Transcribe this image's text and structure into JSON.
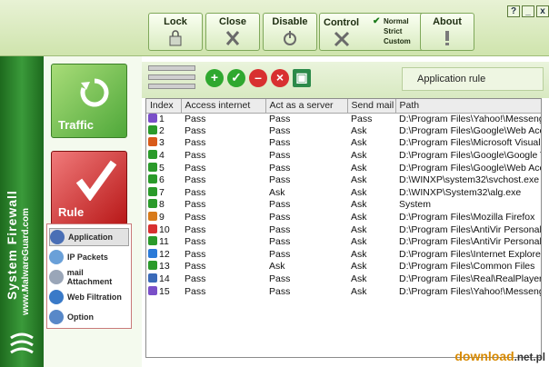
{
  "window": {
    "controls": [
      "?",
      "_",
      "x"
    ],
    "buttons": {
      "lock": "Lock",
      "close": "Close",
      "disable": "Disable",
      "control": "Control",
      "about": "About"
    },
    "modes": {
      "normal": "Normal",
      "strict": "Strict",
      "custom": "Custom",
      "selected": "Normal"
    }
  },
  "brand": {
    "title": "System Firewall",
    "site": "www.MalwareGuard.com"
  },
  "nav": {
    "traffic_label": "Traffic",
    "rule_label": "Rule",
    "submenu": [
      "Application",
      "IP Packets",
      "mail Attachment",
      "Web Filtration",
      "Option"
    ],
    "active": "Application"
  },
  "toolbar": {
    "icons": [
      "add-icon",
      "check-icon",
      "remove-icon",
      "delete-icon",
      "save-icon"
    ],
    "section_label": "Application rule"
  },
  "table": {
    "columns": [
      "Index",
      "Access internet",
      "Act as a server",
      "Send mail",
      "Path"
    ],
    "rows": [
      {
        "index": "1",
        "access": "Pass",
        "server": "Pass",
        "mail": "Pass",
        "path": "D:\\Program Files\\Yahoo!\\Messenger"
      },
      {
        "index": "2",
        "access": "Pass",
        "server": "Pass",
        "mail": "Ask",
        "path": "D:\\Program Files\\Google\\Web Accelerator"
      },
      {
        "index": "3",
        "access": "Pass",
        "server": "Pass",
        "mail": "Ask",
        "path": "D:\\Program Files\\Microsoft Visual Studio"
      },
      {
        "index": "4",
        "access": "Pass",
        "server": "Pass",
        "mail": "Ask",
        "path": "D:\\Program Files\\Google\\Google Talk"
      },
      {
        "index": "5",
        "access": "Pass",
        "server": "Pass",
        "mail": "Ask",
        "path": "D:\\Program Files\\Google\\Web Accelerator"
      },
      {
        "index": "6",
        "access": "Pass",
        "server": "Pass",
        "mail": "Ask",
        "path": "D:\\WINXP\\system32\\svchost.exe"
      },
      {
        "index": "7",
        "access": "Pass",
        "server": "Ask",
        "mail": "Ask",
        "path": "D:\\WINXP\\System32\\alg.exe"
      },
      {
        "index": "8",
        "access": "Pass",
        "server": "Pass",
        "mail": "Ask",
        "path": "System"
      },
      {
        "index": "9",
        "access": "Pass",
        "server": "Pass",
        "mail": "Ask",
        "path": "D:\\Program Files\\Mozilla Firefox"
      },
      {
        "index": "10",
        "access": "Pass",
        "server": "Pass",
        "mail": "Ask",
        "path": "D:\\Program Files\\AntiVir PersonalEdition"
      },
      {
        "index": "11",
        "access": "Pass",
        "server": "Pass",
        "mail": "Ask",
        "path": "D:\\Program Files\\AntiVir PersonalEdition"
      },
      {
        "index": "12",
        "access": "Pass",
        "server": "Pass",
        "mail": "Ask",
        "path": "D:\\Program Files\\Internet Explorer"
      },
      {
        "index": "13",
        "access": "Pass",
        "server": "Ask",
        "mail": "Ask",
        "path": "D:\\Program Files\\Common Files"
      },
      {
        "index": "14",
        "access": "Pass",
        "server": "Pass",
        "mail": "Ask",
        "path": "D:\\Program Files\\Real\\RealPlayer"
      },
      {
        "index": "15",
        "access": "Pass",
        "server": "Pass",
        "mail": "Ask",
        "path": "D:\\Program Files\\Yahoo!\\Messenger"
      }
    ]
  },
  "watermark": {
    "text": "download",
    "suffix": ".net.pl"
  },
  "colors": {
    "accent_green": "#3a9a3a",
    "rule_red": "#b81818",
    "traffic_green": "#4fa83a"
  }
}
